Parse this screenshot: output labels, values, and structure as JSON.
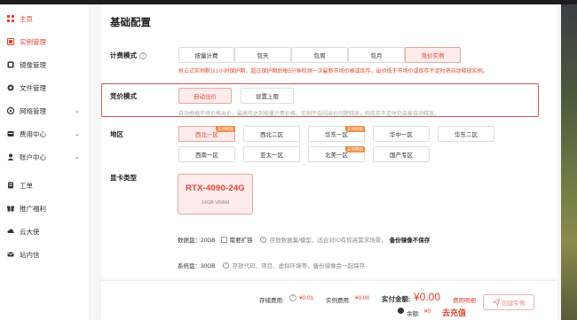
{
  "sidebar": {
    "items": [
      {
        "label": "主页",
        "icon": "grid-icon",
        "has_chevron": false,
        "active": true
      },
      {
        "label": "实例管理",
        "icon": "instance-icon",
        "has_chevron": false,
        "active": true
      },
      {
        "label": "镜像管理",
        "icon": "image-icon",
        "has_chevron": false,
        "active": false
      },
      {
        "label": "文件管理",
        "icon": "file-icon",
        "has_chevron": false,
        "active": false
      },
      {
        "label": "网络管理",
        "icon": "network-icon",
        "has_chevron": true,
        "active": false
      },
      {
        "label": "费用中心",
        "icon": "billing-icon",
        "has_chevron": true,
        "active": false
      },
      {
        "label": "账户中心",
        "icon": "account-icon",
        "has_chevron": true,
        "active": false
      },
      {
        "label": "工单",
        "icon": "ticket-icon",
        "has_chevron": false,
        "active": false
      },
      {
        "label": "推广福利",
        "icon": "gift-icon",
        "has_chevron": false,
        "active": false
      },
      {
        "label": "云大使",
        "icon": "ambassador-icon",
        "has_chevron": false,
        "active": false
      },
      {
        "label": "站内信",
        "icon": "mail-icon",
        "has_chevron": false,
        "active": false
      }
    ]
  },
  "main": {
    "section_title": "基础配置",
    "billing": {
      "label": "计费模式",
      "options": [
        "按量计费",
        "包天",
        "包周",
        "包月",
        "竞价实例"
      ],
      "selected": "竞价实例",
      "warning": "抢占式实例默认1小时保护期，超过保护期后每5分钟检测一次最新市场价格或库存，出价低于市场价或库存不足时将自动释放实例。"
    },
    "bid": {
      "label": "竞价模式",
      "options": [
        "自动出价",
        "设置上限"
      ],
      "selected": "自动出价",
      "hint": "自动根据市场价格出价，最高可达到按量计费价格，实例不会因出价问题释放，但库存不足时仍会被自动释放。"
    },
    "region": {
      "label": "地区",
      "options": [
        "西北一区",
        "西北二区",
        "华东一区",
        "华中一区",
        "华东二区",
        "西南一区",
        "亚太一区",
        "北美一区",
        "国产专区"
      ],
      "tags": {
        "西北一区": "支持网盘",
        "华东一区": "支持网盘",
        "北美一区": "支持网盘"
      },
      "selected": "西北一区"
    },
    "gpu": {
      "label": "显卡类型",
      "name": "RTX-4090-24G",
      "vram": "24GB VRAM"
    },
    "data_disk": {
      "label": "数据盘：20GB",
      "expand_label": "需要扩容",
      "desc": "存放数据集/模型，适合对IO有较高需求场景，",
      "emphasis": "备份镜像不保存"
    },
    "system_disk": {
      "label": "系统盘：30GB",
      "desc": "存放代码、项目、虚拟环境等，备份镜像会一起保存"
    }
  },
  "footer": {
    "storage_label": "存储费用:",
    "storage_value": "¥0.01",
    "instance_label": "实例费用:",
    "instance_value": "¥0.00",
    "pay_label": "实付金额:",
    "pay_value": "¥0.00",
    "detail_link": "费用明细",
    "balance_label": "余额:",
    "balance_value": "¥0",
    "recharge_link": "去充值",
    "create_button": "创建实例"
  },
  "colors": {
    "accent": "#e5402f",
    "selected_bg": "#fdeceb",
    "tag": "#f08a3c",
    "highlight_border": "#d9534f"
  }
}
